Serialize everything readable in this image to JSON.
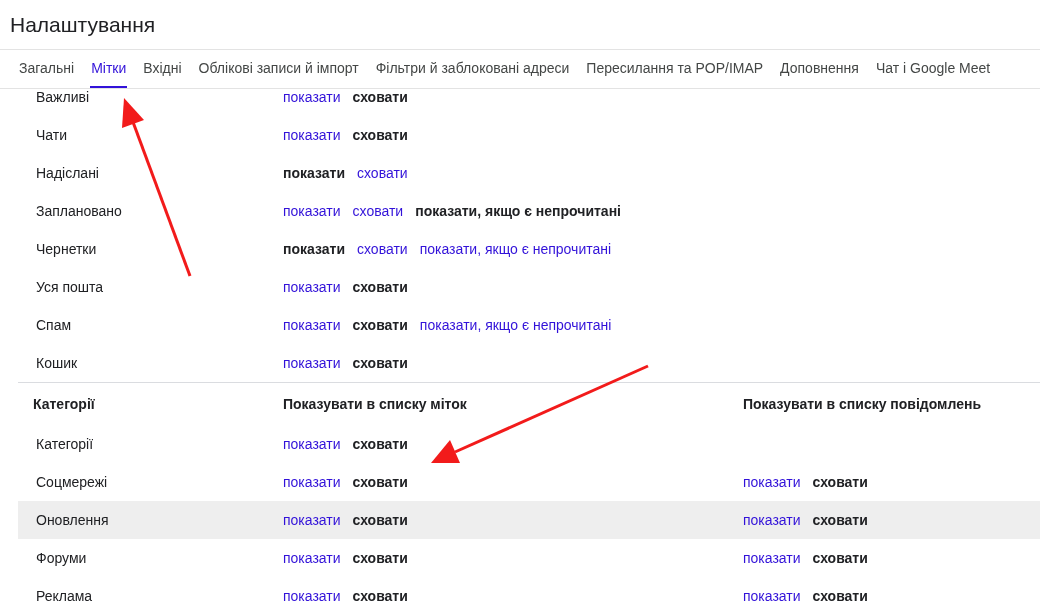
{
  "title": "Налаштування",
  "tabs": [
    {
      "label": "Загальні",
      "selected": false
    },
    {
      "label": "Мітки",
      "selected": true
    },
    {
      "label": "Вхідні",
      "selected": false
    },
    {
      "label": "Облікові записи й імпорт",
      "selected": false
    },
    {
      "label": "Фільтри й заблоковані адреси",
      "selected": false
    },
    {
      "label": "Пересилання та POP/IMAP",
      "selected": false
    },
    {
      "label": "Доповнення",
      "selected": false
    },
    {
      "label": "Чат і Google Meet",
      "selected": false
    }
  ],
  "system_labels": [
    {
      "name": "Важливі",
      "options": [
        {
          "label": "показати",
          "selected": false
        },
        {
          "label": "сховати",
          "selected": true
        }
      ]
    },
    {
      "name": "Чати",
      "options": [
        {
          "label": "показати",
          "selected": false
        },
        {
          "label": "сховати",
          "selected": true
        }
      ]
    },
    {
      "name": "Надіслані",
      "options": [
        {
          "label": "показати",
          "selected": true
        },
        {
          "label": "сховати",
          "selected": false
        }
      ]
    },
    {
      "name": "Заплановано",
      "options": [
        {
          "label": "показати",
          "selected": false
        },
        {
          "label": "сховати",
          "selected": false
        },
        {
          "label": "показати, якщо є непрочитані",
          "selected": true
        }
      ]
    },
    {
      "name": "Чернетки",
      "options": [
        {
          "label": "показати",
          "selected": true
        },
        {
          "label": "сховати",
          "selected": false
        },
        {
          "label": "показати, якщо є непрочитані",
          "selected": false
        }
      ]
    },
    {
      "name": "Уся пошта",
      "options": [
        {
          "label": "показати",
          "selected": false
        },
        {
          "label": "сховати",
          "selected": true
        }
      ]
    },
    {
      "name": "Спам",
      "options": [
        {
          "label": "показати",
          "selected": false
        },
        {
          "label": "сховати",
          "selected": true
        },
        {
          "label": "показати, якщо є непрочитані",
          "selected": false
        }
      ]
    },
    {
      "name": "Кошик",
      "options": [
        {
          "label": "показати",
          "selected": false
        },
        {
          "label": "сховати",
          "selected": true
        }
      ]
    }
  ],
  "categories": {
    "columns": [
      "Категорії",
      "Показувати в списку міток",
      "Показувати в списку повідомлень"
    ],
    "rows": [
      {
        "name": "Категорії",
        "hovered": false,
        "label_list": [
          {
            "label": "показати",
            "selected": false
          },
          {
            "label": "сховати",
            "selected": true
          }
        ]
      },
      {
        "name": "Соцмережі",
        "hovered": false,
        "label_list": [
          {
            "label": "показати",
            "selected": false
          },
          {
            "label": "сховати",
            "selected": true
          }
        ],
        "message_list": [
          {
            "label": "показати",
            "selected": false
          },
          {
            "label": "сховати",
            "selected": true
          }
        ]
      },
      {
        "name": "Оновлення",
        "hovered": true,
        "label_list": [
          {
            "label": "показати",
            "selected": false
          },
          {
            "label": "сховати",
            "selected": true
          }
        ],
        "message_list": [
          {
            "label": "показати",
            "selected": false
          },
          {
            "label": "сховати",
            "selected": true
          }
        ]
      },
      {
        "name": "Форуми",
        "hovered": false,
        "label_list": [
          {
            "label": "показати",
            "selected": false
          },
          {
            "label": "сховати",
            "selected": true
          }
        ],
        "message_list": [
          {
            "label": "показати",
            "selected": false
          },
          {
            "label": "сховати",
            "selected": true
          }
        ]
      },
      {
        "name": "Реклама",
        "hovered": false,
        "label_list": [
          {
            "label": "показати",
            "selected": false
          },
          {
            "label": "сховати",
            "selected": true
          }
        ],
        "message_list": [
          {
            "label": "показати",
            "selected": false
          },
          {
            "label": "сховати",
            "selected": true
          }
        ]
      }
    ]
  }
}
